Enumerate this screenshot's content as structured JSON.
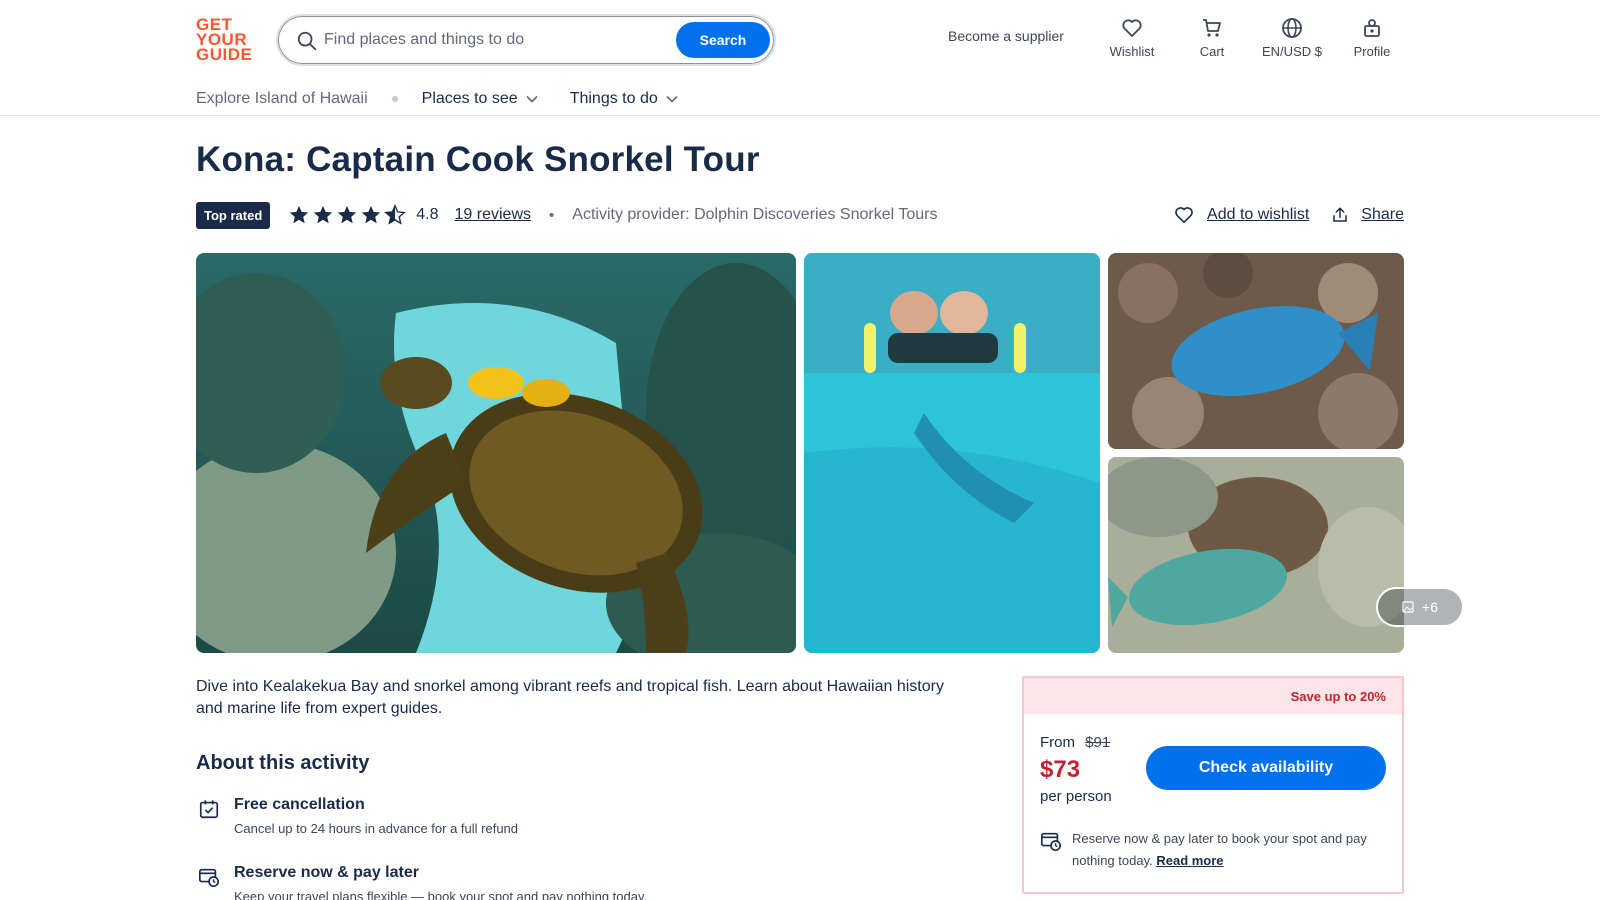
{
  "header": {
    "logo_lines": [
      "GET",
      "YOUR",
      "GUIDE"
    ],
    "search_placeholder": "Find places and things to do",
    "search_button": "Search",
    "supplier_link": "Become a supplier",
    "nav": [
      {
        "label": "Wishlist",
        "icon": "heart-icon"
      },
      {
        "label": "Cart",
        "icon": "cart-icon"
      },
      {
        "label": "EN/USD $",
        "icon": "globe-icon"
      },
      {
        "label": "Profile",
        "icon": "profile-icon"
      }
    ]
  },
  "subnav": {
    "crumb": "Explore Island of Hawaii",
    "dropdowns": [
      "Places to see",
      "Things to do"
    ]
  },
  "activity": {
    "title": "Kona: Captain Cook Snorkel Tour",
    "badge": "Top rated",
    "rating": "4.8",
    "rating_value": 4.8,
    "reviews": "19 reviews",
    "provider": "Activity provider: Dolphin Discoveries Snorkel Tours",
    "wishlist_action": "Add to wishlist",
    "share_action": "Share"
  },
  "gallery": {
    "more_label": "+6"
  },
  "description": "Dive into Kealakekua Bay and snorkel among vibrant reefs and tropical fish. Learn about Hawaiian history and marine life from expert guides.",
  "about": {
    "title": "About this activity",
    "features": [
      {
        "title": "Free cancellation",
        "desc": "Cancel up to 24 hours in advance for a full refund",
        "icon": "calendar-check-icon"
      },
      {
        "title": "Reserve now & pay later",
        "desc": "Keep your travel plans flexible — book your spot and pay nothing today.",
        "icon": "card-clock-icon"
      }
    ]
  },
  "booking": {
    "save_label": "Save up to 20%",
    "from_label": "From",
    "old_price": "$91",
    "price": "$73",
    "per_label": "per person",
    "check_button": "Check availability",
    "reserve_text": "Reserve now & pay later to book your spot and pay nothing today.",
    "read_more": "Read more"
  },
  "colors": {
    "brand": "#ff5533",
    "primary": "#0071eb",
    "navy": "#1a2b49",
    "sale": "#c2232f",
    "sale_bg": "#fde4e8"
  }
}
